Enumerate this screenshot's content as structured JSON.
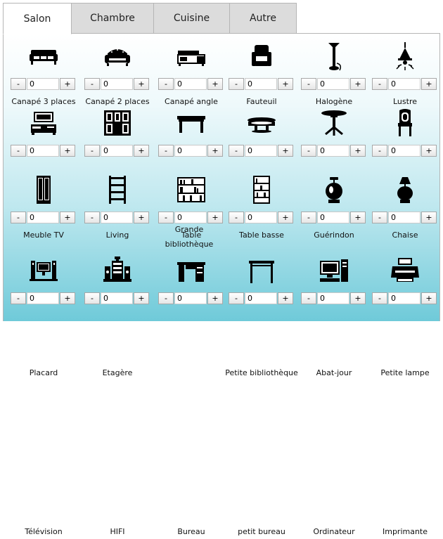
{
  "tabs": [
    {
      "label": "Salon",
      "active": true
    },
    {
      "label": "Chambre",
      "active": false
    },
    {
      "label": "Cuisine",
      "active": false
    },
    {
      "label": "Autre",
      "active": false
    }
  ],
  "stepper": {
    "minus": "-",
    "plus": "+"
  },
  "items": [
    {
      "label": "Canapé 3 places",
      "value": "0",
      "icon": "sofa-3-icon"
    },
    {
      "label": "Canapé 2 places",
      "value": "0",
      "icon": "sofa-2-icon"
    },
    {
      "label": "Canapé angle",
      "value": "0",
      "icon": "corner-sofa-icon"
    },
    {
      "label": "Fauteuil",
      "value": "0",
      "icon": "armchair-icon"
    },
    {
      "label": "Halogène",
      "value": "0",
      "icon": "floor-lamp-icon"
    },
    {
      "label": "Lustre",
      "value": "0",
      "icon": "chandelier-icon"
    },
    {
      "label": "Meuble TV",
      "value": "0",
      "icon": "tv-stand-icon"
    },
    {
      "label": "Living",
      "value": "0",
      "icon": "living-cabinet-icon"
    },
    {
      "label": "Table",
      "value": "0",
      "icon": "table-icon"
    },
    {
      "label": "Table basse",
      "value": "0",
      "icon": "coffee-table-icon"
    },
    {
      "label": "Guérindon",
      "value": "0",
      "icon": "pedestal-table-icon"
    },
    {
      "label": "Chaise",
      "value": "0",
      "icon": "chair-icon"
    },
    {
      "label": "Placard",
      "value": "0",
      "icon": "cupboard-icon"
    },
    {
      "label": "Etagère",
      "value": "0",
      "icon": "shelf-icon"
    },
    {
      "label": "Grande bibliothèque",
      "value": "0",
      "icon": "large-bookcase-icon"
    },
    {
      "label": "Petite bibliothèque",
      "value": "0",
      "icon": "small-bookcase-icon"
    },
    {
      "label": "Abat-jour",
      "value": "0",
      "icon": "table-lamp-icon"
    },
    {
      "label": "Petite lampe",
      "value": "0",
      "icon": "small-lamp-icon"
    },
    {
      "label": "Télévision",
      "value": "0",
      "icon": "television-icon"
    },
    {
      "label": "HIFI",
      "value": "0",
      "icon": "hifi-icon"
    },
    {
      "label": "Bureau",
      "value": "0",
      "icon": "desk-icon"
    },
    {
      "label": "petit bureau",
      "value": "0",
      "icon": "small-desk-icon"
    },
    {
      "label": "Ordinateur",
      "value": "0",
      "icon": "computer-icon"
    },
    {
      "label": "Imprimante",
      "value": "0",
      "icon": "printer-icon"
    }
  ]
}
